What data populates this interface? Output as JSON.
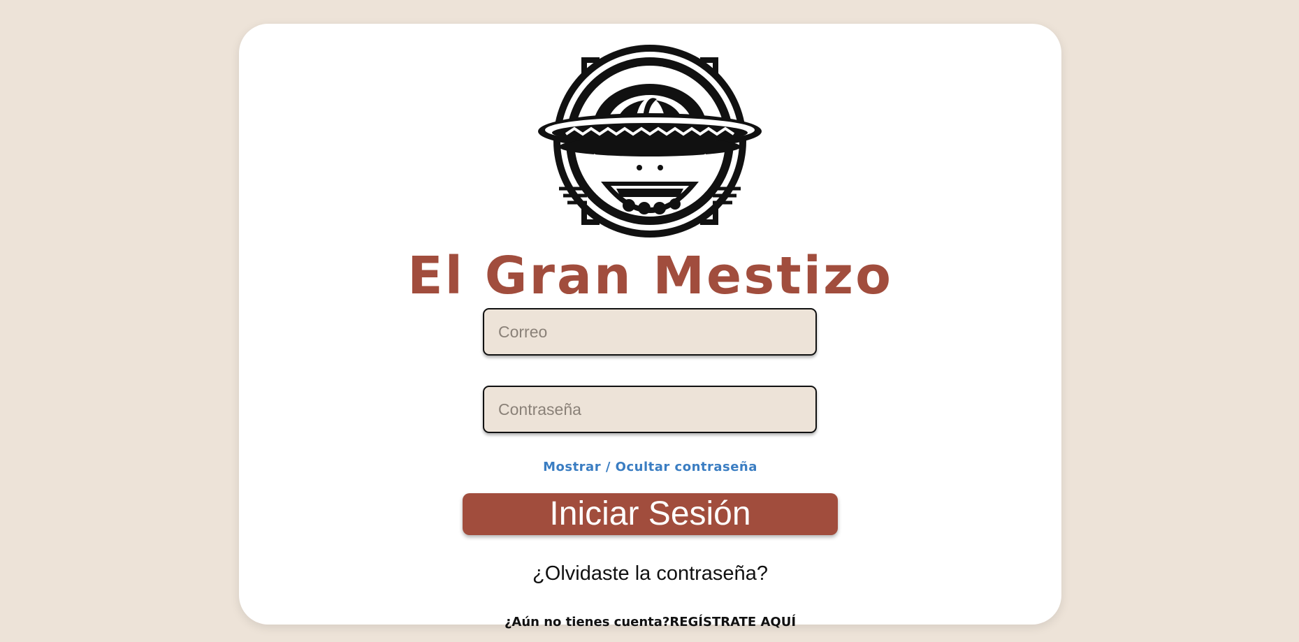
{
  "brand": {
    "name": "El Gran Mestizo",
    "color": "#a14d3d"
  },
  "logo": {
    "icon": "sombrero-skull-logo"
  },
  "form": {
    "email_placeholder": "Correo",
    "email_value": "",
    "password_placeholder": "Contraseña",
    "password_value": "",
    "toggle_password_label": "Mostrar / Ocultar contraseña",
    "login_label": "Iniciar Sesión",
    "forgot_label": "¿Olvidaste la contraseña?",
    "register_prompt": "¿Aún no tienes cuenta?",
    "register_link": "REGÍSTRATE AQUÍ"
  },
  "colors": {
    "background": "#ede3d8",
    "card": "#ffffff",
    "accent": "#a14d3d",
    "link": "#3a7dc2"
  }
}
